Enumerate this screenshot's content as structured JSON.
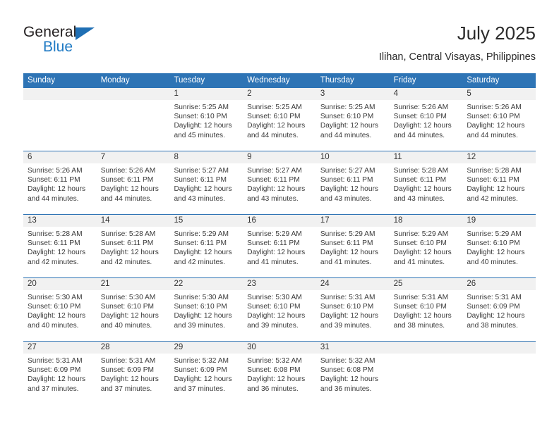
{
  "logo": {
    "word1": "General",
    "word2": "Blue",
    "triangle_color": "#1f6fb4",
    "blue_text_color": "#1f7ac4"
  },
  "header": {
    "title": "July 2025",
    "subtitle": "Ilihan, Central Visayas, Philippines"
  },
  "theme": {
    "header_blue": "#2e74b5",
    "daynum_band": "#f1f1f1",
    "cell_bg": "#ffffff",
    "text": "#3a3a3a"
  },
  "weekdays": [
    "Sunday",
    "Monday",
    "Tuesday",
    "Wednesday",
    "Thursday",
    "Friday",
    "Saturday"
  ],
  "labels": {
    "sunrise_prefix": "Sunrise:",
    "sunset_prefix": "Sunset:",
    "daylight_prefix": "Daylight:"
  },
  "weeks": [
    [
      {
        "day": "",
        "empty": true
      },
      {
        "day": "",
        "empty": true
      },
      {
        "day": "1",
        "sunrise": "Sunrise: 5:25 AM",
        "sunset": "Sunset: 6:10 PM",
        "daylight_l1": "Daylight: 12 hours",
        "daylight_l2": "and 45 minutes."
      },
      {
        "day": "2",
        "sunrise": "Sunrise: 5:25 AM",
        "sunset": "Sunset: 6:10 PM",
        "daylight_l1": "Daylight: 12 hours",
        "daylight_l2": "and 44 minutes."
      },
      {
        "day": "3",
        "sunrise": "Sunrise: 5:25 AM",
        "sunset": "Sunset: 6:10 PM",
        "daylight_l1": "Daylight: 12 hours",
        "daylight_l2": "and 44 minutes."
      },
      {
        "day": "4",
        "sunrise": "Sunrise: 5:26 AM",
        "sunset": "Sunset: 6:10 PM",
        "daylight_l1": "Daylight: 12 hours",
        "daylight_l2": "and 44 minutes."
      },
      {
        "day": "5",
        "sunrise": "Sunrise: 5:26 AM",
        "sunset": "Sunset: 6:10 PM",
        "daylight_l1": "Daylight: 12 hours",
        "daylight_l2": "and 44 minutes."
      }
    ],
    [
      {
        "day": "6",
        "sunrise": "Sunrise: 5:26 AM",
        "sunset": "Sunset: 6:11 PM",
        "daylight_l1": "Daylight: 12 hours",
        "daylight_l2": "and 44 minutes."
      },
      {
        "day": "7",
        "sunrise": "Sunrise: 5:26 AM",
        "sunset": "Sunset: 6:11 PM",
        "daylight_l1": "Daylight: 12 hours",
        "daylight_l2": "and 44 minutes."
      },
      {
        "day": "8",
        "sunrise": "Sunrise: 5:27 AM",
        "sunset": "Sunset: 6:11 PM",
        "daylight_l1": "Daylight: 12 hours",
        "daylight_l2": "and 43 minutes."
      },
      {
        "day": "9",
        "sunrise": "Sunrise: 5:27 AM",
        "sunset": "Sunset: 6:11 PM",
        "daylight_l1": "Daylight: 12 hours",
        "daylight_l2": "and 43 minutes."
      },
      {
        "day": "10",
        "sunrise": "Sunrise: 5:27 AM",
        "sunset": "Sunset: 6:11 PM",
        "daylight_l1": "Daylight: 12 hours",
        "daylight_l2": "and 43 minutes."
      },
      {
        "day": "11",
        "sunrise": "Sunrise: 5:28 AM",
        "sunset": "Sunset: 6:11 PM",
        "daylight_l1": "Daylight: 12 hours",
        "daylight_l2": "and 43 minutes."
      },
      {
        "day": "12",
        "sunrise": "Sunrise: 5:28 AM",
        "sunset": "Sunset: 6:11 PM",
        "daylight_l1": "Daylight: 12 hours",
        "daylight_l2": "and 42 minutes."
      }
    ],
    [
      {
        "day": "13",
        "sunrise": "Sunrise: 5:28 AM",
        "sunset": "Sunset: 6:11 PM",
        "daylight_l1": "Daylight: 12 hours",
        "daylight_l2": "and 42 minutes."
      },
      {
        "day": "14",
        "sunrise": "Sunrise: 5:28 AM",
        "sunset": "Sunset: 6:11 PM",
        "daylight_l1": "Daylight: 12 hours",
        "daylight_l2": "and 42 minutes."
      },
      {
        "day": "15",
        "sunrise": "Sunrise: 5:29 AM",
        "sunset": "Sunset: 6:11 PM",
        "daylight_l1": "Daylight: 12 hours",
        "daylight_l2": "and 42 minutes."
      },
      {
        "day": "16",
        "sunrise": "Sunrise: 5:29 AM",
        "sunset": "Sunset: 6:11 PM",
        "daylight_l1": "Daylight: 12 hours",
        "daylight_l2": "and 41 minutes."
      },
      {
        "day": "17",
        "sunrise": "Sunrise: 5:29 AM",
        "sunset": "Sunset: 6:11 PM",
        "daylight_l1": "Daylight: 12 hours",
        "daylight_l2": "and 41 minutes."
      },
      {
        "day": "18",
        "sunrise": "Sunrise: 5:29 AM",
        "sunset": "Sunset: 6:10 PM",
        "daylight_l1": "Daylight: 12 hours",
        "daylight_l2": "and 41 minutes."
      },
      {
        "day": "19",
        "sunrise": "Sunrise: 5:29 AM",
        "sunset": "Sunset: 6:10 PM",
        "daylight_l1": "Daylight: 12 hours",
        "daylight_l2": "and 40 minutes."
      }
    ],
    [
      {
        "day": "20",
        "sunrise": "Sunrise: 5:30 AM",
        "sunset": "Sunset: 6:10 PM",
        "daylight_l1": "Daylight: 12 hours",
        "daylight_l2": "and 40 minutes."
      },
      {
        "day": "21",
        "sunrise": "Sunrise: 5:30 AM",
        "sunset": "Sunset: 6:10 PM",
        "daylight_l1": "Daylight: 12 hours",
        "daylight_l2": "and 40 minutes."
      },
      {
        "day": "22",
        "sunrise": "Sunrise: 5:30 AM",
        "sunset": "Sunset: 6:10 PM",
        "daylight_l1": "Daylight: 12 hours",
        "daylight_l2": "and 39 minutes."
      },
      {
        "day": "23",
        "sunrise": "Sunrise: 5:30 AM",
        "sunset": "Sunset: 6:10 PM",
        "daylight_l1": "Daylight: 12 hours",
        "daylight_l2": "and 39 minutes."
      },
      {
        "day": "24",
        "sunrise": "Sunrise: 5:31 AM",
        "sunset": "Sunset: 6:10 PM",
        "daylight_l1": "Daylight: 12 hours",
        "daylight_l2": "and 39 minutes."
      },
      {
        "day": "25",
        "sunrise": "Sunrise: 5:31 AM",
        "sunset": "Sunset: 6:10 PM",
        "daylight_l1": "Daylight: 12 hours",
        "daylight_l2": "and 38 minutes."
      },
      {
        "day": "26",
        "sunrise": "Sunrise: 5:31 AM",
        "sunset": "Sunset: 6:09 PM",
        "daylight_l1": "Daylight: 12 hours",
        "daylight_l2": "and 38 minutes."
      }
    ],
    [
      {
        "day": "27",
        "sunrise": "Sunrise: 5:31 AM",
        "sunset": "Sunset: 6:09 PM",
        "daylight_l1": "Daylight: 12 hours",
        "daylight_l2": "and 37 minutes."
      },
      {
        "day": "28",
        "sunrise": "Sunrise: 5:31 AM",
        "sunset": "Sunset: 6:09 PM",
        "daylight_l1": "Daylight: 12 hours",
        "daylight_l2": "and 37 minutes."
      },
      {
        "day": "29",
        "sunrise": "Sunrise: 5:32 AM",
        "sunset": "Sunset: 6:09 PM",
        "daylight_l1": "Daylight: 12 hours",
        "daylight_l2": "and 37 minutes."
      },
      {
        "day": "30",
        "sunrise": "Sunrise: 5:32 AM",
        "sunset": "Sunset: 6:08 PM",
        "daylight_l1": "Daylight: 12 hours",
        "daylight_l2": "and 36 minutes."
      },
      {
        "day": "31",
        "sunrise": "Sunrise: 5:32 AM",
        "sunset": "Sunset: 6:08 PM",
        "daylight_l1": "Daylight: 12 hours",
        "daylight_l2": "and 36 minutes."
      },
      {
        "day": "",
        "empty": true
      },
      {
        "day": "",
        "empty": true
      }
    ]
  ]
}
